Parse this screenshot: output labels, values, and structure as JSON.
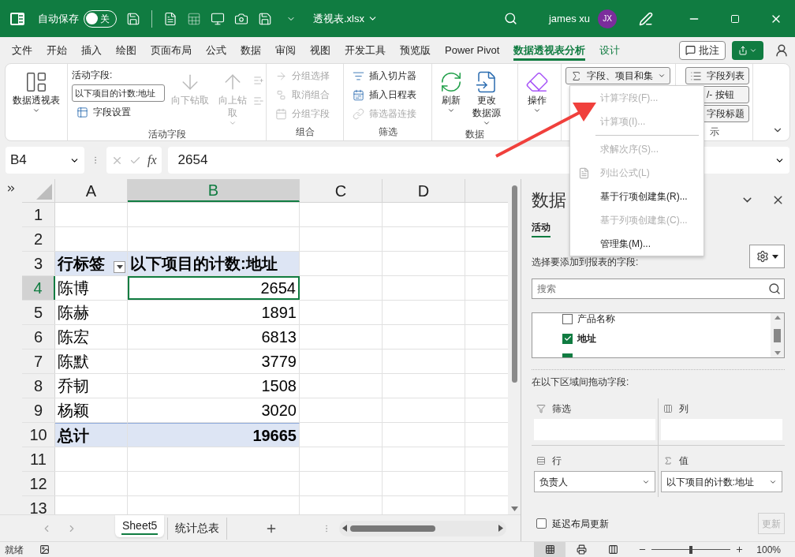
{
  "title_bar": {
    "autosave_label": "自动保存",
    "autosave": {
      "on": false,
      "label": "关"
    },
    "filename": "透视表.xlsx",
    "user": "james xu",
    "avatar": "JX"
  },
  "menu_tabs": [
    {
      "label": "文件",
      "selected": false,
      "contextual": false
    },
    {
      "label": "开始",
      "selected": false,
      "contextual": false
    },
    {
      "label": "插入",
      "selected": false,
      "contextual": false
    },
    {
      "label": "绘图",
      "selected": false,
      "contextual": false
    },
    {
      "label": "页面布局",
      "selected": false,
      "contextual": false
    },
    {
      "label": "公式",
      "selected": false,
      "contextual": false
    },
    {
      "label": "数据",
      "selected": false,
      "contextual": false
    },
    {
      "label": "审阅",
      "selected": false,
      "contextual": false
    },
    {
      "label": "视图",
      "selected": false,
      "contextual": false
    },
    {
      "label": "开发工具",
      "selected": false,
      "contextual": false
    },
    {
      "label": "预览版",
      "selected": false,
      "contextual": false
    },
    {
      "label": "Power Pivot",
      "selected": false,
      "contextual": false
    },
    {
      "label": "数据透视表分析",
      "selected": true,
      "contextual": true
    },
    {
      "label": "设计",
      "selected": false,
      "contextual": true
    }
  ],
  "comment_button": "批注",
  "ribbon": {
    "groups": [
      {
        "columns": [
          [
            {
              "kind": "large",
              "lines": [
                "数据透视表"
              ],
              "dropdown": true,
              "disabled": false
            }
          ]
        ]
      },
      {
        "label": "活动字段",
        "columns": [
          [
            {
              "kind": "caption",
              "label": "活动字段:"
            },
            {
              "kind": "field",
              "value": "以下项目的计数:地址"
            },
            {
              "kind": "small",
              "label": "字段设置",
              "disabled": false,
              "selected": false,
              "dropdown": false
            }
          ],
          [
            {
              "kind": "large",
              "lines": [
                "向下钻取"
              ],
              "dropdown": false,
              "disabled": true
            }
          ],
          [
            {
              "kind": "large",
              "lines": [
                "向上钻",
                "取"
              ],
              "dropdown": true,
              "disabled": true
            }
          ],
          [
            {
              "kind": "tiny",
              "disabled": true
            },
            {
              "kind": "tiny",
              "disabled": true
            }
          ]
        ]
      },
      {
        "label": "组合",
        "columns": [
          [
            {
              "kind": "small",
              "label": "分组选择",
              "disabled": true,
              "selected": false,
              "dropdown": false
            },
            {
              "kind": "small",
              "label": "取消组合",
              "disabled": true,
              "selected": false,
              "dropdown": false
            },
            {
              "kind": "small",
              "label": "分组字段",
              "disabled": true,
              "selected": false,
              "dropdown": false
            }
          ]
        ]
      },
      {
        "label": "筛选",
        "columns": [
          [
            {
              "kind": "small",
              "label": "插入切片器",
              "disabled": false,
              "selected": false,
              "dropdown": false
            },
            {
              "kind": "small",
              "label": "插入日程表",
              "disabled": false,
              "selected": false,
              "dropdown": false
            },
            {
              "kind": "small",
              "label": "筛选器连接",
              "disabled": true,
              "selected": false,
              "dropdown": false
            }
          ]
        ]
      },
      {
        "label": "数据",
        "columns": [
          [
            {
              "kind": "large",
              "lines": [
                "刷新"
              ],
              "dropdown": true,
              "disabled": false
            }
          ],
          [
            {
              "kind": "large",
              "lines": [
                "更改",
                "数据源"
              ],
              "dropdown": true,
              "disabled": false
            }
          ]
        ]
      },
      {
        "columns": [
          [
            {
              "kind": "large",
              "lines": [
                "操作"
              ],
              "dropdown": true,
              "disabled": false
            }
          ]
        ]
      },
      {
        "columns": [
          [
            {
              "kind": "small",
              "label": "字段、项目和集",
              "disabled": false,
              "selected": true,
              "dropdown": true
            }
          ]
        ]
      },
      {
        "label": "示",
        "columns": [
          [
            {
              "kind": "small",
              "label": "字段列表",
              "disabled": false,
              "selected": true,
              "dropdown": false
            },
            {
              "kind": "small",
              "label": "/- 按钮",
              "disabled": false,
              "selected": true,
              "dropdown": false
            },
            {
              "kind": "small",
              "label": "字段标题",
              "disabled": false,
              "selected": true,
              "dropdown": false
            }
          ]
        ]
      }
    ]
  },
  "dropdown_menu": [
    {
      "kind": "item",
      "label": "计算字段(F)...",
      "disabled": true
    },
    {
      "kind": "item",
      "label": "计算项(I)...",
      "disabled": true
    },
    {
      "kind": "separator"
    },
    {
      "kind": "item",
      "label": "求解次序(S)...",
      "disabled": true
    },
    {
      "kind": "icon_item",
      "label": "列出公式(L)",
      "disabled": true
    },
    {
      "kind": "item",
      "label": "基于行项创建集(R)...",
      "disabled": false
    },
    {
      "kind": "item",
      "label": "基于列项创建集(C)...",
      "disabled": true
    },
    {
      "kind": "item",
      "label": "管理集(M)...",
      "disabled": false
    }
  ],
  "formula_bar": {
    "name_box": "B4",
    "function_label": "fx",
    "value": "2654"
  },
  "sheet": {
    "columns": [
      {
        "label": "A",
        "selected": false
      },
      {
        "label": "B",
        "selected": true
      },
      {
        "label": "C",
        "selected": false
      },
      {
        "label": "D",
        "selected": false
      }
    ],
    "rows": [
      {
        "label": "1",
        "selected": false,
        "kind": "empty"
      },
      {
        "label": "2",
        "selected": false,
        "kind": "empty"
      },
      {
        "label": "3",
        "selected": false,
        "kind": "header",
        "cells": [
          {
            "text": "行标签",
            "selected": false
          },
          {
            "text": "以下项目的计数:地址",
            "selected": false
          }
        ]
      },
      {
        "label": "4",
        "selected": true,
        "kind": "data",
        "cells": [
          {
            "text": "陈博",
            "selected": false
          },
          {
            "text": "2654",
            "selected": true
          }
        ]
      },
      {
        "label": "5",
        "selected": false,
        "kind": "data",
        "cells": [
          {
            "text": "陈赫",
            "selected": false
          },
          {
            "text": "1891",
            "selected": false
          }
        ]
      },
      {
        "label": "6",
        "selected": false,
        "kind": "data",
        "cells": [
          {
            "text": "陈宏",
            "selected": false
          },
          {
            "text": "6813",
            "selected": false
          }
        ]
      },
      {
        "label": "7",
        "selected": false,
        "kind": "data",
        "cells": [
          {
            "text": "陈默",
            "selected": false
          },
          {
            "text": "3779",
            "selected": false
          }
        ]
      },
      {
        "label": "8",
        "selected": false,
        "kind": "data",
        "cells": [
          {
            "text": "乔韧",
            "selected": false
          },
          {
            "text": "1508",
            "selected": false
          }
        ]
      },
      {
        "label": "9",
        "selected": false,
        "kind": "data",
        "cells": [
          {
            "text": "杨颖",
            "selected": false
          },
          {
            "text": "3020",
            "selected": false
          }
        ]
      },
      {
        "label": "10",
        "selected": false,
        "kind": "total",
        "cells": [
          {
            "text": "总计",
            "selected": false
          },
          {
            "text": "19665",
            "selected": false
          }
        ]
      },
      {
        "label": "11",
        "selected": false,
        "kind": "empty"
      },
      {
        "label": "12",
        "selected": false,
        "kind": "empty"
      },
      {
        "label": "13",
        "selected": false,
        "kind": "empty"
      }
    ]
  },
  "sheet_tabs": [
    {
      "label": "Sheet5",
      "selected": true
    },
    {
      "label": "统计总表",
      "selected": false
    }
  ],
  "field_pane": {
    "title": "数据",
    "tabs": [
      {
        "label": "活动",
        "selected": true
      }
    ],
    "prompt": "选择要添加到报表的字段:",
    "search_placeholder": "搜索",
    "fields": [
      {
        "label": "产品名称",
        "checked": false
      },
      {
        "label": "地址",
        "checked": true
      },
      {
        "checked": true
      }
    ],
    "drag_prompt": "在以下区域间拖动字段:",
    "areas": [
      {
        "kind": "filter",
        "label": "筛选"
      },
      {
        "kind": "columns",
        "label": "列"
      },
      {
        "kind": "rows",
        "label": "行",
        "items": [
          "负责人"
        ]
      },
      {
        "kind": "values",
        "label": "值",
        "items": [
          "以下项目的计数:地址"
        ]
      }
    ],
    "defer": {
      "label": "延迟布局更新",
      "checked": false
    },
    "update": {
      "label": "更新",
      "disabled": true
    }
  },
  "status_bar": {
    "status": "就绪",
    "view_modes": [
      {
        "selected": true
      },
      {
        "selected": false
      },
      {
        "selected": false
      }
    ],
    "zoom": {
      "level": 0.5,
      "label": "100%"
    }
  }
}
